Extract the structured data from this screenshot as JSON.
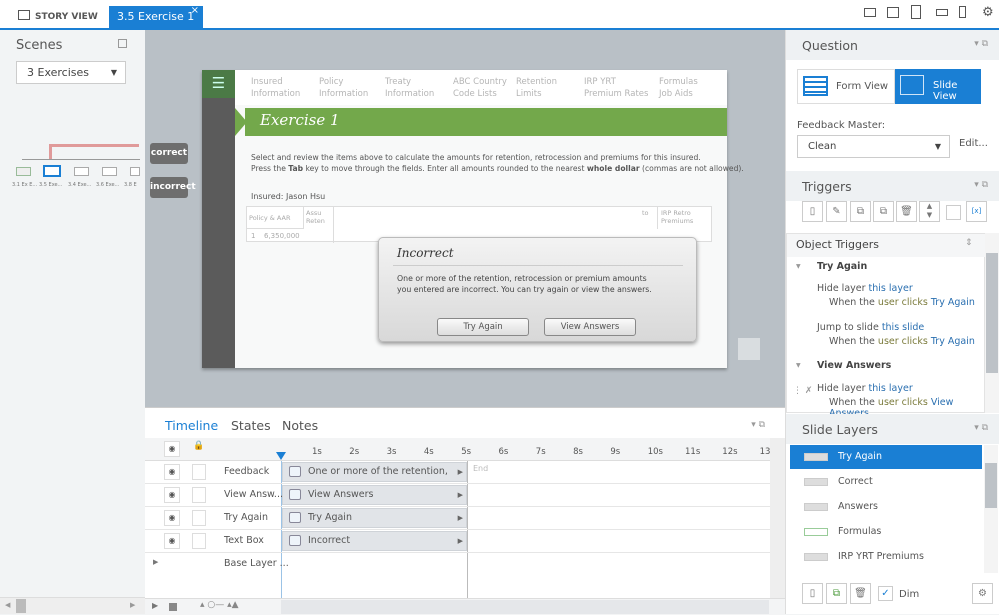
{
  "topbar": {
    "tabs": [
      {
        "label": "STORY VIEW"
      },
      {
        "label": "3.5 Exercise 1",
        "close": "×"
      }
    ],
    "device_icons": [
      "desktop-icon",
      "tablet-landscape-icon",
      "tablet-portrait-icon",
      "phone-landscape-icon",
      "phone-portrait-icon",
      "gear-icon"
    ]
  },
  "scenes": {
    "title": "Scenes",
    "selected": "3 Exercises",
    "slides": [
      "3.1 Ex E...",
      "3.5 Exe...",
      "3.4 Exe...",
      "3.6 Exe...",
      "3.8 E"
    ]
  },
  "slide_buttons": {
    "correct": "correct",
    "incorrect": "incorrect"
  },
  "slide": {
    "nav": [
      {
        "l1": "Insured",
        "l2": "Information"
      },
      {
        "l1": "Policy",
        "l2": "Information"
      },
      {
        "l1": "Treaty",
        "l2": "Information"
      },
      {
        "l1": "ABC Country",
        "l2": "Code Lists"
      },
      {
        "l1": "Retention",
        "l2": "Limits"
      },
      {
        "l1": "IRP YRT",
        "l2": "Premium Rates"
      },
      {
        "l1": "Formulas",
        "l2": "Job Aids"
      }
    ],
    "title": "Exercise 1",
    "line1": "Select and review the items above to calculate the amounts for retention, retrocession and premiums for this insured.",
    "line2a": "Press the ",
    "tab": "Tab",
    "line2b": " key to move through the fields.  Enter all amounts rounded to the nearest ",
    "whole": "whole dollar",
    "line2c": " (commas are not allowed).",
    "insured": "Insured:  Jason Hsu",
    "table": {
      "h1": "Policy & AAR",
      "h2": "Assu Reten",
      "h3": "to",
      "h4": "IRP Retro Premiums",
      "row_num": "1",
      "row_val": "6,350,000"
    },
    "dialog": {
      "title": "Incorrect",
      "text1": "One or more of the retention, retrocession or premium amounts",
      "text2": "you entered are incorrect.  You can try again or view the answers.",
      "try": "Try Again",
      "view": "View Answers"
    }
  },
  "timeline": {
    "tabs": [
      "Timeline",
      "States",
      "Notes"
    ],
    "ticks": [
      "1s",
      "2s",
      "3s",
      "4s",
      "5s",
      "6s",
      "7s",
      "8s",
      "9s",
      "10s",
      "11s",
      "12s",
      "13"
    ],
    "end": "End",
    "rows": [
      {
        "name": "Feedback",
        "bar": "One or more of the retention, retr..."
      },
      {
        "name": "View Answ...",
        "bar": "View Answers"
      },
      {
        "name": "Try Again",
        "bar": "Try Again"
      },
      {
        "name": "Text Box",
        "bar": "Incorrect"
      }
    ],
    "base": "Base Layer ..."
  },
  "question": {
    "title": "Question",
    "form_view": "Form View",
    "slide_view": "Slide View",
    "feedback_label": "Feedback Master:",
    "feedback_value": "Clean",
    "edit": "Edit..."
  },
  "triggers": {
    "title": "Triggers",
    "object_triggers": "Object Triggers",
    "groups": [
      {
        "name": "Try Again"
      },
      {
        "name": "View Answers"
      }
    ],
    "items": [
      {
        "a": "Hide layer ",
        "t": "this layer",
        "w": "When the ",
        "u": "user clicks",
        "o": "Try Again"
      },
      {
        "a": "Jump to slide ",
        "t": "this slide",
        "w": "When the ",
        "u": "user clicks",
        "o": "Try Again"
      },
      {
        "a": "Hide layer ",
        "t": "this layer",
        "w": "When the ",
        "u": "user clicks",
        "o": "View Answers"
      }
    ]
  },
  "layers": {
    "title": "Slide Layers",
    "items": [
      "Try Again",
      "Correct",
      "Answers",
      "Formulas",
      "IRP YRT Premiums"
    ],
    "dim": "Dim",
    "dim_checked": true
  },
  "colors": {
    "accent": "#1a7fd4",
    "banner": "#73a84b"
  }
}
